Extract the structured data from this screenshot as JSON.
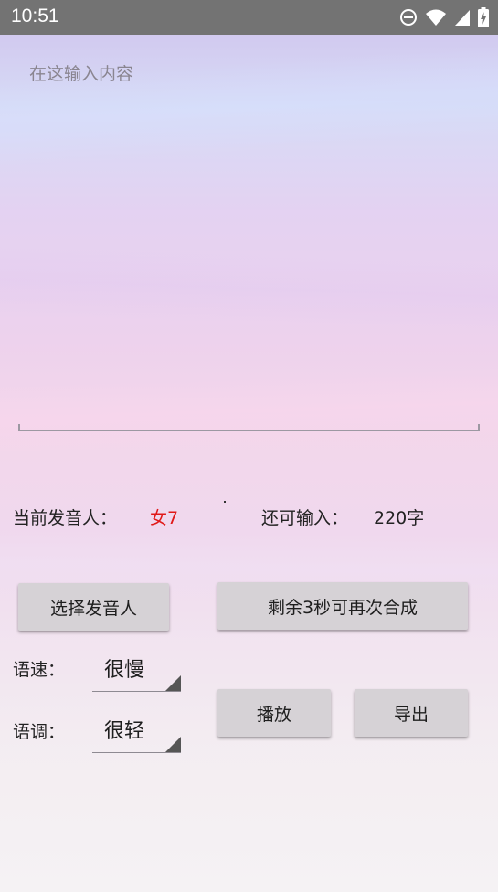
{
  "status_bar": {
    "time": "10:51",
    "icons": [
      "do-not-disturb-icon",
      "wifi-icon",
      "signal-icon",
      "battery-icon"
    ]
  },
  "input": {
    "placeholder": "在这输入内容",
    "value": ""
  },
  "info": {
    "speaker_label": "当前发音人：",
    "speaker_value": "女7",
    "speaker_value_color": "#e01818",
    "remaining_label": "还可输入：",
    "remaining_value": "220字"
  },
  "buttons": {
    "select_speaker": "选择发音人",
    "synthesize": "剩余3秒可再次合成",
    "play": "播放",
    "export": "导出"
  },
  "speed": {
    "label": "语速：",
    "selected": "很慢"
  },
  "pitch": {
    "label": "语调：",
    "selected": "很轻"
  }
}
